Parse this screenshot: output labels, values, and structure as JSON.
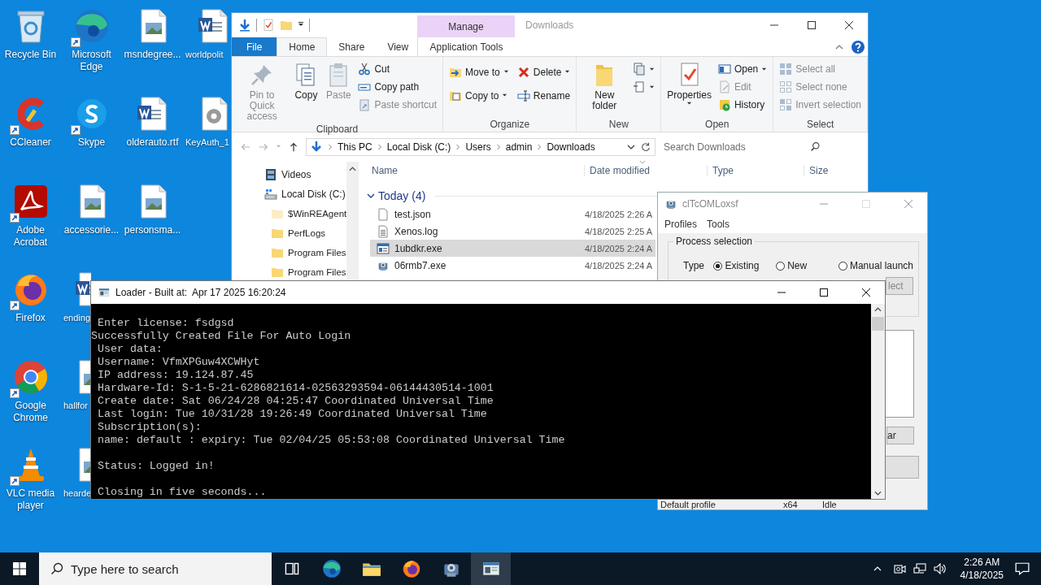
{
  "desktop_columns": [
    [
      {
        "label": "Recycle Bin",
        "kind": "recycle",
        "shortcut": false,
        "cut": false,
        "icon_cut": false
      },
      {
        "label": "CCleaner",
        "kind": "ccleaner",
        "shortcut": true,
        "cut": false,
        "icon_cut": false
      },
      {
        "label": "Adobe Acrobat",
        "kind": "acrobat",
        "shortcut": true,
        "cut": false,
        "icon_cut": false
      },
      {
        "label": "Firefox",
        "kind": "firefox",
        "shortcut": true,
        "cut": false,
        "icon_cut": false
      },
      {
        "label": "Google Chrome",
        "kind": "chrome",
        "shortcut": true,
        "cut": false,
        "icon_cut": false
      },
      {
        "label": "VLC media player",
        "kind": "vlc",
        "shortcut": true,
        "cut": false,
        "icon_cut": false
      }
    ],
    [
      {
        "label": "Microsoft Edge",
        "kind": "edge",
        "shortcut": true,
        "cut": false,
        "icon_cut": false
      },
      {
        "label": "Skype",
        "kind": "skype",
        "shortcut": true,
        "cut": false,
        "icon_cut": false
      },
      {
        "label": "accessorie...",
        "kind": "image",
        "shortcut": false,
        "cut": false,
        "icon_cut": false
      },
      {
        "label": "ending",
        "kind": "word",
        "shortcut": false,
        "cut": true,
        "icon_cut": true
      },
      {
        "label": "hallfor",
        "kind": "image",
        "shortcut": false,
        "cut": true,
        "icon_cut": true
      },
      {
        "label": "hearde",
        "kind": "image",
        "shortcut": false,
        "cut": true,
        "icon_cut": true
      }
    ],
    [
      {
        "label": "msndegree...",
        "kind": "image",
        "shortcut": false,
        "cut": false,
        "icon_cut": false
      },
      {
        "label": "olderauto.rtf",
        "kind": "word",
        "shortcut": false,
        "cut": false,
        "icon_cut": false
      },
      {
        "label": "personsma...",
        "kind": "image",
        "shortcut": false,
        "cut": false,
        "icon_cut": false
      }
    ],
    [
      {
        "label": "worldpolit",
        "kind": "word",
        "shortcut": false,
        "cut": true,
        "icon_cut": false
      },
      {
        "label": "KeyAuth_1",
        "kind": "settings",
        "shortcut": false,
        "cut": true,
        "icon_cut": false
      }
    ]
  ],
  "explorer": {
    "title": "Downloads",
    "tabs": [
      {
        "label": "File",
        "kind": "file",
        "selected": false
      },
      {
        "label": "Home",
        "kind": "normal",
        "selected": true
      },
      {
        "label": "Share",
        "kind": "normal",
        "selected": false
      },
      {
        "label": "View",
        "kind": "normal",
        "selected": false
      }
    ],
    "contextual_tab": {
      "header": "Manage",
      "label": "Application Tools",
      "selected": false
    },
    "ribbon": [
      {
        "label": "Clipboard",
        "items": [
          {
            "label": "Pin to Quick access",
            "large": true,
            "disabled": true,
            "dropdown": false
          },
          {
            "label": "Copy",
            "large": true,
            "disabled": false,
            "dropdown": false
          },
          {
            "label": "Paste",
            "large": true,
            "disabled": true,
            "dropdown": false
          },
          {
            "label": "Cut",
            "large": false,
            "disabled": false,
            "dropdown": false
          },
          {
            "label": "Copy path",
            "large": false,
            "disabled": false,
            "dropdown": false
          },
          {
            "label": "Paste shortcut",
            "large": false,
            "disabled": true,
            "dropdown": false
          }
        ]
      },
      {
        "label": "Organize",
        "items": [
          {
            "label": "Move to",
            "large": false,
            "disabled": false,
            "dropdown": true
          },
          {
            "label": "Copy to",
            "large": false,
            "disabled": false,
            "dropdown": true
          },
          {
            "label": "Delete",
            "large": false,
            "disabled": false,
            "dropdown": true
          },
          {
            "label": "Rename",
            "large": false,
            "disabled": false,
            "dropdown": false
          }
        ]
      },
      {
        "label": "New",
        "items": [
          {
            "label": "New folder",
            "large": true,
            "disabled": false,
            "dropdown": false
          },
          {
            "large": false,
            "disabled": false,
            "dropdown": true
          },
          {
            "large": false,
            "disabled": false,
            "dropdown": true
          }
        ]
      },
      {
        "label": "Open",
        "items": [
          {
            "label": "Properties",
            "large": true,
            "disabled": false,
            "dropdown": true
          },
          {
            "label": "Open",
            "large": false,
            "disabled": false,
            "dropdown": true
          },
          {
            "label": "Edit",
            "large": false,
            "disabled": true,
            "dropdown": false
          },
          {
            "label": "History",
            "large": false,
            "disabled": false,
            "dropdown": false
          }
        ]
      },
      {
        "label": "Select",
        "items": [
          {
            "label": "Select all",
            "large": false,
            "disabled": true,
            "dropdown": false
          },
          {
            "label": "Select none",
            "large": false,
            "disabled": true,
            "dropdown": false
          },
          {
            "label": "Invert selection",
            "large": false,
            "disabled": true,
            "dropdown": false
          }
        ]
      }
    ],
    "breadcrumbs": [
      "This PC",
      "Local Disk (C:)",
      "Users",
      "admin",
      "Downloads"
    ],
    "search": {
      "placeholder": "Search Downloads"
    },
    "nav_pane": [
      {
        "label": "Videos",
        "kind": "videos"
      },
      {
        "label": "Local Disk (C:)",
        "kind": "drive",
        "children": [
          {
            "label": "$WinREAgent",
            "kind": "folder",
            "hidden": true
          },
          {
            "label": "PerfLogs",
            "kind": "folder",
            "hidden": false
          },
          {
            "label": "Program Files",
            "kind": "folder",
            "hidden": false
          },
          {
            "label": "Program Files",
            "kind": "folder",
            "hidden": false
          }
        ]
      }
    ],
    "columns": [
      "Name",
      "Date modified",
      "Type",
      "Size"
    ],
    "group": "Today (4)",
    "files": [
      {
        "name": "test.json",
        "date": "4/18/2025 2:26 A",
        "kind": "document",
        "selected": false
      },
      {
        "name": "Xenos.log",
        "date": "4/18/2025 2:25 A",
        "kind": "textfile",
        "selected": false
      },
      {
        "name": "1ubdkr.exe",
        "date": "4/18/2025 2:24 A",
        "kind": "program",
        "selected": true
      },
      {
        "name": "06rmb7.exe",
        "date": "4/18/2025 2:24 A",
        "kind": "gearapp",
        "selected": false
      }
    ]
  },
  "injector": {
    "title": "clTcOMLoxsf",
    "menu": [
      "Profiles",
      "Tools"
    ],
    "group": "Process selection",
    "type_label": "Type",
    "options": [
      {
        "label": "Existing",
        "selected": true
      },
      {
        "label": "New",
        "selected": false
      },
      {
        "label": "Manual launch",
        "selected": false
      }
    ],
    "select_button": "lect",
    "clear_button": "ar",
    "profile_row": [
      "Default profile",
      "x64",
      "Idle"
    ]
  },
  "console": {
    "title": "Loader - Built at:  Apr 17 2025 16:20:24",
    "lines": [
      {
        "text": "Enter license: fsdgsd",
        "indented": true,
        "blank_before": false
      },
      {
        "text": "Successfully Created File For Auto Login",
        "indented": false,
        "blank_before": false
      },
      {
        "text": "User data:",
        "indented": true,
        "blank_before": false
      },
      {
        "text": "Username: VfmXPGuw4XCWHyt",
        "indented": true,
        "blank_before": false
      },
      {
        "text": "IP address: 19.124.87.45",
        "indented": true,
        "blank_before": false
      },
      {
        "text": "Hardware-Id: S-1-5-21-6286821614-02563293594-06144430514-1001",
        "indented": true,
        "blank_before": false
      },
      {
        "text": "Create date: Sat 06/24/28 04:25:47 Coordinated Universal Time",
        "indented": true,
        "blank_before": false
      },
      {
        "text": "Last login: Tue 10/31/28 19:26:49 Coordinated Universal Time",
        "indented": true,
        "blank_before": false
      },
      {
        "text": "Subscription(s):",
        "indented": true,
        "blank_before": false
      },
      {
        "text": "name: default : expiry: Tue 02/04/25 05:53:08 Coordinated Universal Time",
        "indented": true,
        "blank_before": false
      },
      {
        "text": "Status: Logged in!",
        "indented": true,
        "blank_before": true
      },
      {
        "text": "Closing in five seconds...",
        "indented": true,
        "blank_before": true
      }
    ]
  },
  "taskbar": {
    "search": {
      "placeholder": "Type here to search"
    },
    "apps": [
      {
        "kind": "taskview",
        "active": false
      },
      {
        "kind": "edge",
        "active": false
      },
      {
        "kind": "explorer",
        "active": false
      },
      {
        "kind": "firefox",
        "active": false
      },
      {
        "kind": "gearapp",
        "active": false
      },
      {
        "kind": "console",
        "active": true
      }
    ],
    "time": "2:26 AM",
    "date": "4/18/2025"
  }
}
